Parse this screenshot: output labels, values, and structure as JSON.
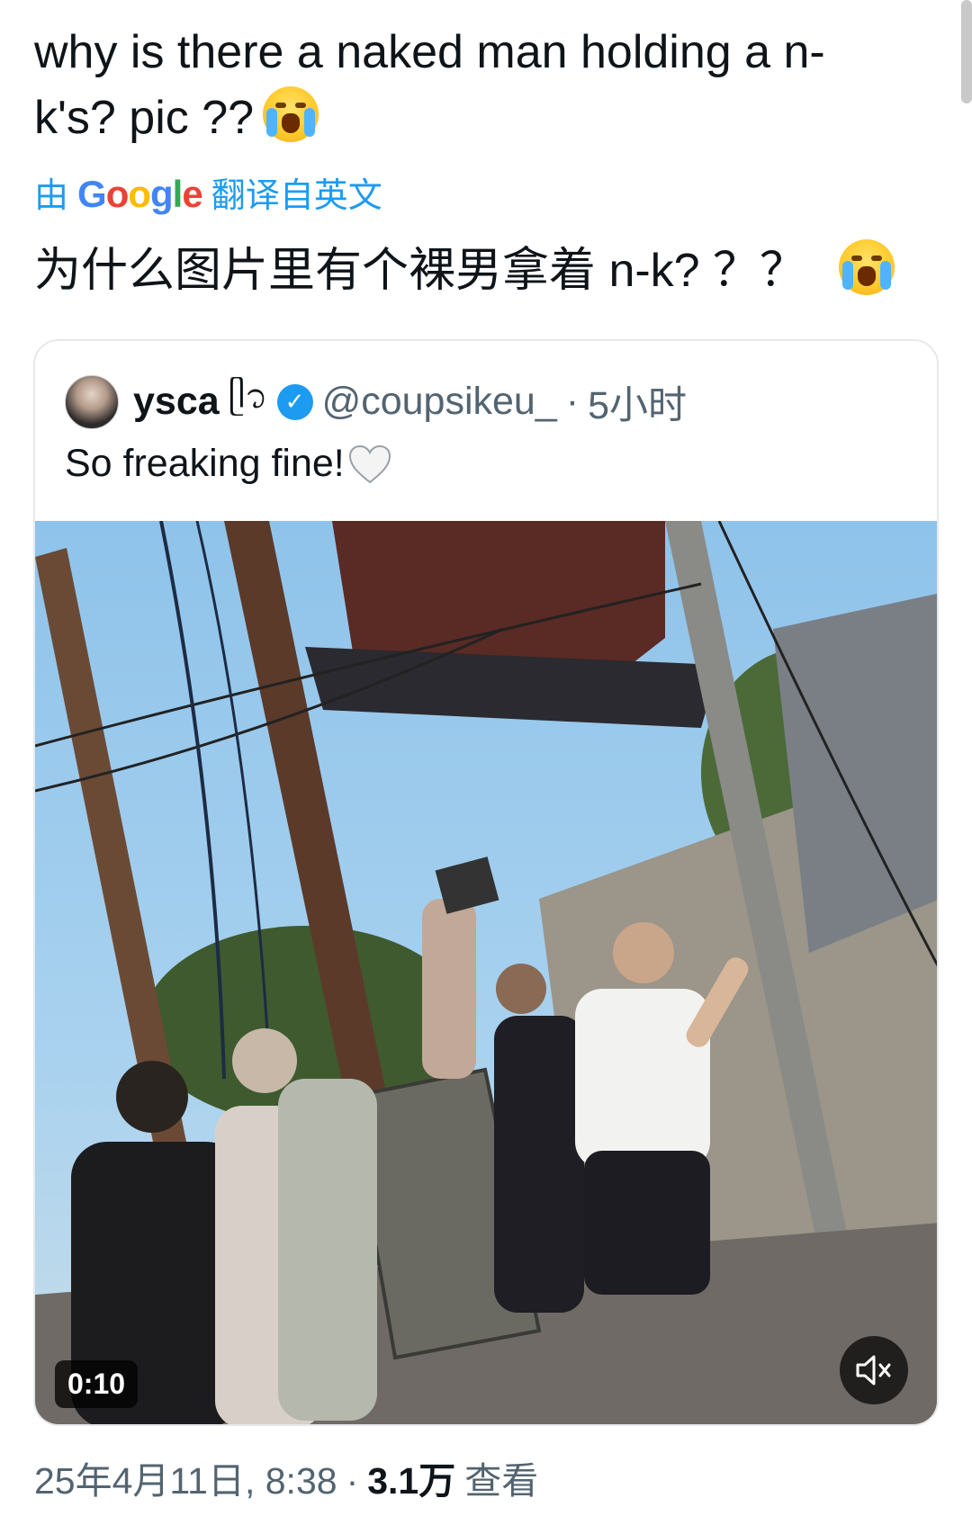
{
  "tweet": {
    "text": "why is there a naked man holding a n-k's? pic ??",
    "emoji": "loudly-crying-face"
  },
  "translation": {
    "prefix": "由",
    "provider": "Google",
    "suffix": "翻译自英文",
    "text": "为什么图片里有个裸男拿着 n-k? ？？"
  },
  "quote": {
    "name": "ysca",
    "name_deco": "ᥫ᭡",
    "handle": "@coupsikeu_",
    "separator": "·",
    "time": "5小时",
    "text": "So freaking fine!",
    "video": {
      "duration": "0:10",
      "muted": true
    }
  },
  "meta": {
    "date": "25年4月11日, 8:38",
    "separator": "·",
    "views": "3.1万",
    "views_label": "查看"
  },
  "colors": {
    "accent": "#1d9bf0",
    "text": "#0f1419",
    "secondary": "#536471"
  }
}
